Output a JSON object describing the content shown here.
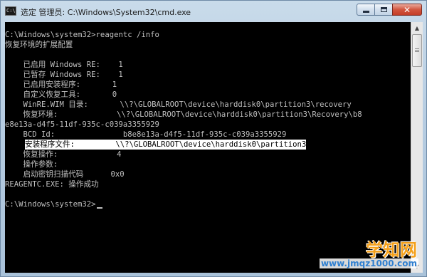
{
  "window": {
    "title": "选定 管理员: C:\\Windows\\System32\\cmd.exe",
    "icon_text": "C:\\"
  },
  "console": {
    "lines": [
      "C:\\Windows\\system32>reagentc /info",
      "恢复环境的扩展配置",
      "",
      "    已启用 Windows RE:    1",
      "    已暂存 Windows RE:    1",
      "    已启用安装程序:       1",
      "    自定义恢复工具:       0",
      "    WinRE.WIM 目录:       \\\\?\\GLOBALROOT\\device\\harddisk0\\partition3\\recovery",
      "    恢复环境:             \\\\?\\GLOBALROOT\\device\\harddisk0\\partition3\\Recovery\\b8",
      "e8e13a-d4f5-11df-935c-c039a3355929",
      "    BCD Id:               b8e8e13a-d4f5-11df-935c-c039a3355929",
      "    安装程序文件:         \\\\?\\GLOBALROOT\\device\\harddisk0\\partition3",
      "    恢复操作:             4",
      "    操作参数:",
      "    启动密钥扫描代码      0x0",
      "REAGENTC.EXE: 操作成功",
      "",
      "C:\\Windows\\system32>"
    ],
    "highlighted_line": 11
  },
  "watermark": {
    "title": "学知网",
    "url": "www.jmqz1000.com"
  },
  "colors": {
    "console_bg": "#000000",
    "console_fg": "#c0c0c0",
    "highlight_bg": "#ffffff",
    "watermark_orange": "#f4a01a",
    "watermark_blue": "#2f7fd0"
  },
  "icons": {
    "minimize": "minimize-icon",
    "maximize": "maximize-icon",
    "close": "close-icon",
    "scroll_up": "scroll-up-arrow-icon",
    "scroll_down": "scroll-down-arrow-icon"
  }
}
